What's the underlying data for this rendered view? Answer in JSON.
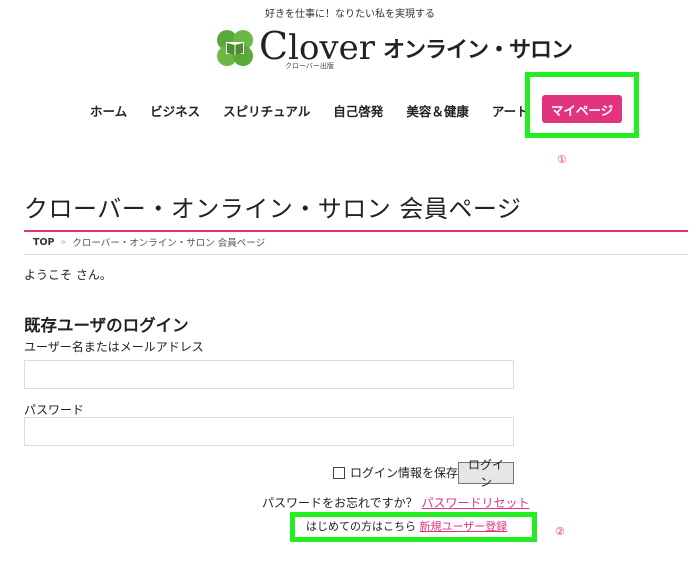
{
  "header": {
    "tagline": "好きを仕事に！なりたい私を実現する",
    "logo": {
      "word_initial": "C",
      "word_rest": "lover",
      "sub": "クローバー出版",
      "jp": "オンライン・サロン"
    }
  },
  "nav": {
    "items": [
      "ホーム",
      "ビジネス",
      "スピリチュアル",
      "自己啓発",
      "美容＆健康",
      "アート"
    ],
    "mypage": "マイページ"
  },
  "annotations": {
    "mark1": "①",
    "mark2": "②"
  },
  "page": {
    "title": "クローバー・オンライン・サロン 会員ページ",
    "breadcrumb": {
      "top": "TOP",
      "separator": "»",
      "current": "クローバー・オンライン・サロン 会員ページ"
    },
    "welcome": "ようこそ さん。"
  },
  "login": {
    "heading": "既存ユーザのログイン",
    "username_label": "ユーザー名またはメールアドレス",
    "username_value": "",
    "password_label": "パスワード",
    "password_value": "",
    "remember_label": "ログイン情報を保存",
    "login_button": "ログイン",
    "forgot_text": "パスワードをお忘れですか？",
    "reset_link": "パスワードリセット",
    "first_time_text": "はじめての方はこちら",
    "register_link": "新規ユーザー登録"
  },
  "colors": {
    "accent": "#e0357e",
    "highlight": "#22ee22",
    "logo_green": "#5aa83a"
  }
}
